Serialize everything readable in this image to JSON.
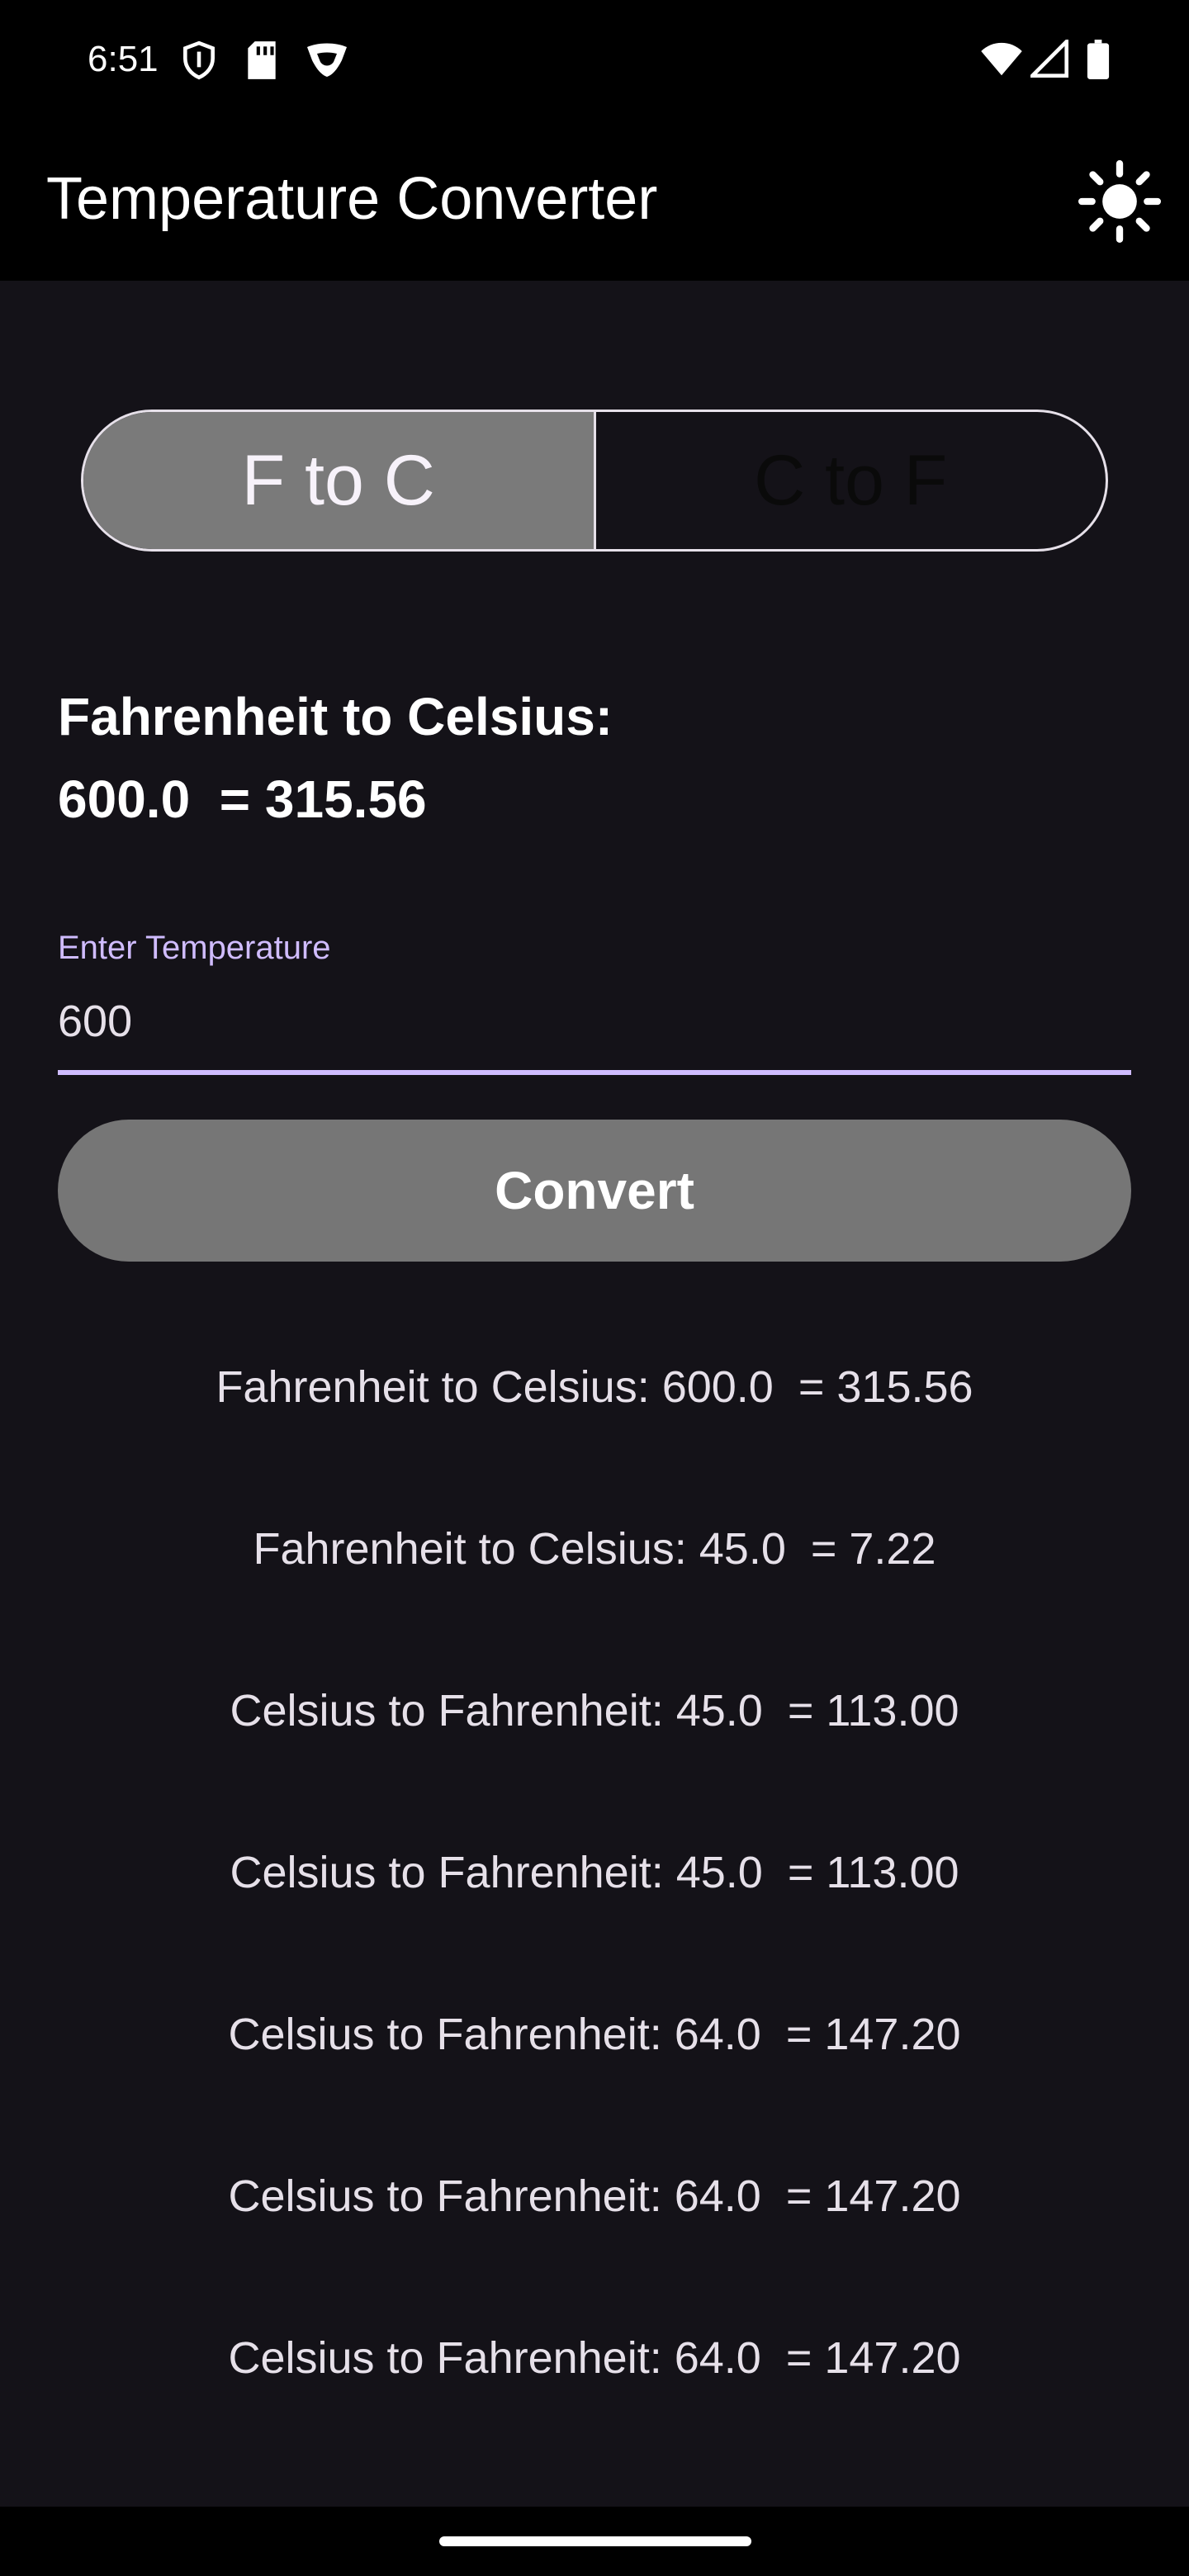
{
  "status_bar": {
    "time": "6:51",
    "left_icons": [
      "shield-icon",
      "sd-card-icon",
      "vpn-key-icon"
    ],
    "right_icons": [
      "wifi-icon",
      "signal-icon",
      "battery-icon"
    ]
  },
  "app_bar": {
    "title": "Temperature Converter",
    "theme_icon": "sun-icon"
  },
  "mode_toggle": {
    "options": [
      {
        "label": "F to C",
        "selected": true
      },
      {
        "label": "C to F",
        "selected": false
      }
    ]
  },
  "result": {
    "heading": "Fahrenheit to Celsius:",
    "value": "600.0  = 315.56"
  },
  "input": {
    "label": "Enter Temperature",
    "value": "600"
  },
  "convert_button": {
    "label": "Convert"
  },
  "history": [
    "Fahrenheit to Celsius: 600.0  = 315.56",
    "Fahrenheit to Celsius: 45.0  = 7.22",
    "Celsius to Fahrenheit: 45.0  = 113.00",
    "Celsius to Fahrenheit: 45.0  = 113.00",
    "Celsius to Fahrenheit: 64.0  = 147.20",
    "Celsius to Fahrenheit: 64.0  = 147.20",
    "Celsius to Fahrenheit: 64.0  = 147.20"
  ],
  "colors": {
    "background": "#141218",
    "accent": "#D0BCFF",
    "button": "#767676",
    "selected_segment": "#7A7A7A"
  }
}
